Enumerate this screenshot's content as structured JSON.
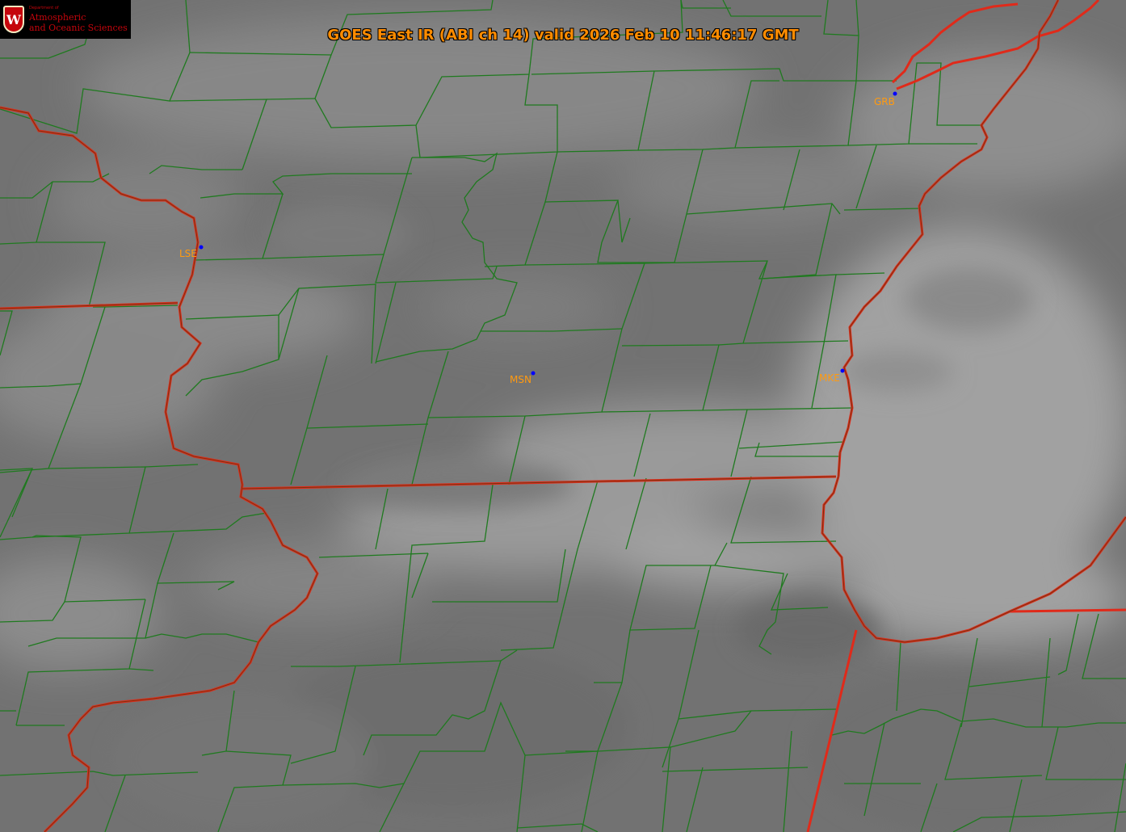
{
  "title": "GOES East IR (ABI ch 14) valid 2026 Feb 10 11:46:17 GMT",
  "logo": {
    "department": "Department of",
    "line1": "Atmospheric",
    "line2": "and Oceanic Sciences",
    "crest_letter": "W"
  },
  "stations": [
    {
      "id": "LSE",
      "label": "LSE"
    },
    {
      "id": "MSN",
      "label": "MSN"
    },
    {
      "id": "MKE",
      "label": "MKE"
    },
    {
      "id": "GRB",
      "label": "GRB"
    }
  ],
  "colors": {
    "county_lines": "#1f7a1f",
    "state_borders": "#e02a1a",
    "station_labels": "#ff9a10",
    "station_markers": "#0000ff",
    "title_text": "#ff8c00"
  }
}
